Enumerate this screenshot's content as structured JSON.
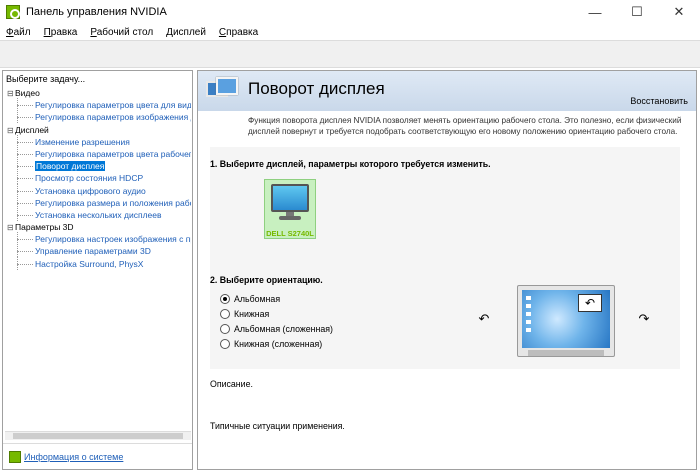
{
  "window": {
    "title": "Панель управления NVIDIA",
    "minimize": "—",
    "maximize": "☐",
    "close": "✕"
  },
  "menu": [
    {
      "label": "Файл",
      "key": "Ф",
      "rest": "айл"
    },
    {
      "label": "Правка",
      "key": "П",
      "rest": "равка"
    },
    {
      "label": "Рабочий стол",
      "key": "Р",
      "rest": "абочий стол"
    },
    {
      "label": "Дисплей",
      "key": "Д",
      "rest": "исплей"
    },
    {
      "label": "Справка",
      "key": "С",
      "rest": "правка"
    }
  ],
  "sidebar": {
    "heading": "Выберите задачу...",
    "tree": [
      {
        "type": "cat",
        "label": "Видео"
      },
      {
        "type": "leaf",
        "label": "Регулировка параметров цвета для вид"
      },
      {
        "type": "leaf",
        "label": "Регулировка параметров изображения д"
      },
      {
        "type": "cat",
        "label": "Дисплей"
      },
      {
        "type": "leaf",
        "label": "Изменение разрешения"
      },
      {
        "type": "leaf",
        "label": "Регулировка параметров цвета рабочег"
      },
      {
        "type": "leaf",
        "label": "Поворот дисплея",
        "selected": true
      },
      {
        "type": "leaf",
        "label": "Просмотр состояния HDCP"
      },
      {
        "type": "leaf",
        "label": "Установка цифрового аудио"
      },
      {
        "type": "leaf",
        "label": "Регулировка размера и положения рабо"
      },
      {
        "type": "leaf",
        "label": "Установка нескольких дисплеев"
      },
      {
        "type": "cat",
        "label": "Параметры 3D"
      },
      {
        "type": "leaf",
        "label": "Регулировка настроек изображения с пр"
      },
      {
        "type": "leaf",
        "label": "Управление параметрами 3D"
      },
      {
        "type": "leaf",
        "label": "Настройка Surround, PhysX"
      }
    ],
    "system_info": "Информация о системе"
  },
  "main": {
    "title": "Поворот дисплея",
    "restore": "Восстановить",
    "description": "Функция поворота дисплея NVIDIA позволяет менять ориентацию рабочего стола. Это полезно, если физический дисплей повернут и требуется подобрать соответствующую его новому положению ориентацию рабочего стола.",
    "step1": "1. Выберите дисплей, параметры которого требуется изменить.",
    "display_name": "DELL S2740L",
    "step2": "2. Выберите ориентацию.",
    "orientations": [
      {
        "label": "Альбомная",
        "checked": true
      },
      {
        "label": "Книжная",
        "checked": false
      },
      {
        "label": "Альбомная (сложенная)",
        "checked": false
      },
      {
        "label": "Книжная (сложенная)",
        "checked": false
      }
    ],
    "rotate_left_icon": "↶",
    "rotate_right_icon": "↷",
    "preview_icon": "↶",
    "description_label": "Описание.",
    "usage_label": "Типичные ситуации применения."
  },
  "colors": {
    "nvidia_green": "#76b900",
    "link_blue": "#1f5fb8",
    "selection": "#0078d7"
  }
}
